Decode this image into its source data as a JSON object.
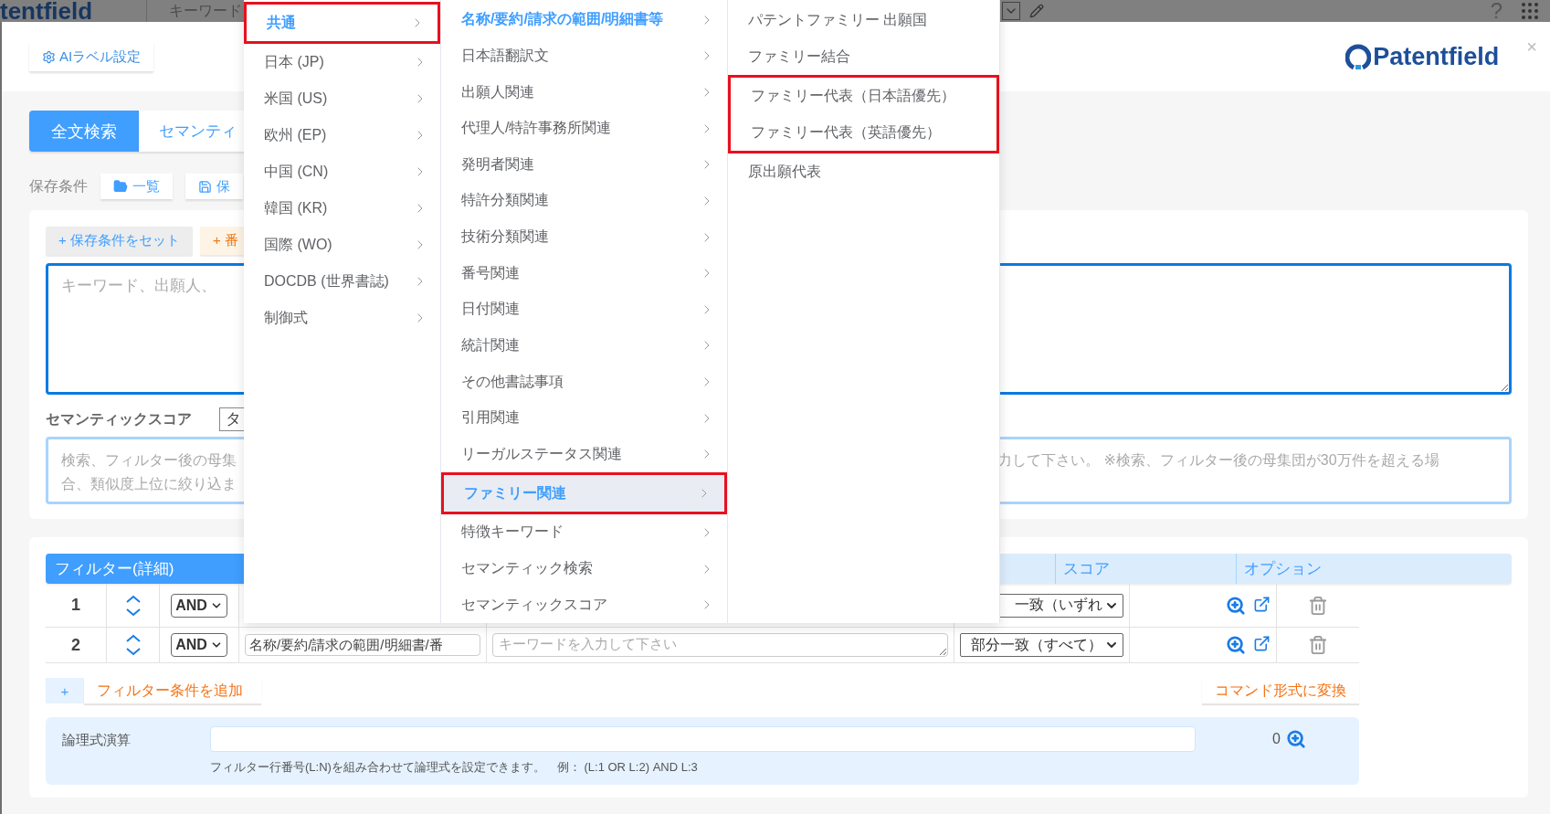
{
  "background": {
    "logo": "tentfield",
    "search_placeholder": "キーワード",
    "help": "?"
  },
  "header": {
    "ai_label_button": "AIラベル設定",
    "logo": "Patentfield",
    "close": "×"
  },
  "tabs": [
    {
      "label": "全文検索",
      "selected": true
    },
    {
      "label": "セマンティ",
      "selected": false
    }
  ],
  "saved_conditions": {
    "label": "保存条件",
    "buttons": [
      {
        "kind": "list",
        "label": "一覧"
      },
      {
        "kind": "save",
        "label": "保"
      }
    ]
  },
  "search": {
    "buttons": [
      {
        "kind": "set",
        "label": "+ 保存条件をセット"
      },
      {
        "kind": "number",
        "label": "+ 番"
      }
    ],
    "placeholder": "キーワード、出願人、"
  },
  "semantic_score": {
    "label": "セマンティックスコア",
    "select": "タ",
    "placeholder_left": [
      "検索、フィルター後の母集",
      "合、類似度上位に絞り込ま"
    ],
    "placeholder_right": "力して下さい。 ※検索、フィルター後の母集団が30万件を超える場"
  },
  "filter": {
    "title": "フィルター(詳細)",
    "columns": [
      "スコア",
      "オプション"
    ],
    "rows": [
      {
        "number": "1",
        "operator": "AND",
        "match": "一致（いずれ"
      },
      {
        "number": "2",
        "operator": "AND",
        "field": "名称/要約/請求の範囲/明細書/番",
        "placeholder": "キーワードを入力して下さい",
        "match": "部分一致（すべて）"
      }
    ],
    "add_button": "+",
    "add_label": "フィルター条件を追加",
    "convert_button": "コマンド形式に変換"
  },
  "logic": {
    "label": "論理式演算",
    "count": "0",
    "help": "フィルター行番号(L:N)を組み合わせて論理式を設定できます。　例：  (L:1 OR L:2) AND L:3"
  },
  "menus": [
    {
      "items": [
        {
          "label": "共通",
          "selected": true,
          "hovered": false,
          "highlighted": true,
          "submenu": true
        },
        {
          "label": "日本 (JP)",
          "selected": false,
          "hovered": false,
          "highlighted": false,
          "submenu": true
        },
        {
          "label": "米国 (US)",
          "selected": false,
          "hovered": false,
          "highlighted": false,
          "submenu": true
        },
        {
          "label": "欧州 (EP)",
          "selected": false,
          "hovered": false,
          "highlighted": false,
          "submenu": true
        },
        {
          "label": "中国 (CN)",
          "selected": false,
          "hovered": false,
          "highlighted": false,
          "submenu": true
        },
        {
          "label": "韓国 (KR)",
          "selected": false,
          "hovered": false,
          "highlighted": false,
          "submenu": true
        },
        {
          "label": "国際 (WO)",
          "selected": false,
          "hovered": false,
          "highlighted": false,
          "submenu": true
        },
        {
          "label": "DOCDB (世界書誌)",
          "selected": false,
          "hovered": false,
          "highlighted": false,
          "submenu": true
        },
        {
          "label": "制御式",
          "selected": false,
          "hovered": false,
          "highlighted": false,
          "submenu": true
        }
      ]
    },
    {
      "items": [
        {
          "label": "名称/要約/請求の範囲/明細書等",
          "selected": true,
          "hovered": false,
          "highlighted": false,
          "submenu": true
        },
        {
          "label": "日本語翻訳文",
          "selected": false,
          "hovered": false,
          "highlighted": false,
          "submenu": true
        },
        {
          "label": "出願人関連",
          "selected": false,
          "hovered": false,
          "highlighted": false,
          "submenu": true
        },
        {
          "label": "代理人/特許事務所関連",
          "selected": false,
          "hovered": false,
          "highlighted": false,
          "submenu": true
        },
        {
          "label": "発明者関連",
          "selected": false,
          "hovered": false,
          "highlighted": false,
          "submenu": true
        },
        {
          "label": "特許分類関連",
          "selected": false,
          "hovered": false,
          "highlighted": false,
          "submenu": true
        },
        {
          "label": "技術分類関連",
          "selected": false,
          "hovered": false,
          "highlighted": false,
          "submenu": true
        },
        {
          "label": "番号関連",
          "selected": false,
          "hovered": false,
          "highlighted": false,
          "submenu": true
        },
        {
          "label": "日付関連",
          "selected": false,
          "hovered": false,
          "highlighted": false,
          "submenu": true
        },
        {
          "label": "統計関連",
          "selected": false,
          "hovered": false,
          "highlighted": false,
          "submenu": true
        },
        {
          "label": "その他書誌事項",
          "selected": false,
          "hovered": false,
          "highlighted": false,
          "submenu": true
        },
        {
          "label": "引用関連",
          "selected": false,
          "hovered": false,
          "highlighted": false,
          "submenu": true
        },
        {
          "label": "リーガルステータス関連",
          "selected": false,
          "hovered": false,
          "highlighted": false,
          "submenu": true
        },
        {
          "label": "ファミリー関連",
          "selected": true,
          "hovered": true,
          "highlighted": true,
          "submenu": true
        },
        {
          "label": "特徴キーワード",
          "selected": false,
          "hovered": false,
          "highlighted": false,
          "submenu": true
        },
        {
          "label": "セマンティック検索",
          "selected": false,
          "hovered": false,
          "highlighted": false,
          "submenu": true
        },
        {
          "label": "セマンティックスコア",
          "selected": false,
          "hovered": false,
          "highlighted": false,
          "submenu": true
        }
      ]
    },
    {
      "items": [
        {
          "label": "パテントファミリー 出願国",
          "selected": false,
          "hovered": false,
          "highlighted": false,
          "submenu": false
        },
        {
          "label": "ファミリー結合",
          "selected": false,
          "hovered": false,
          "highlighted": false,
          "submenu": false
        },
        {
          "label": "ファミリー代表（日本語優先）",
          "selected": false,
          "hovered": false,
          "highlighted": true,
          "submenu": false
        },
        {
          "label": "ファミリー代表（英語優先）",
          "selected": false,
          "hovered": false,
          "highlighted": true,
          "submenu": false
        },
        {
          "label": "原出願代表",
          "selected": false,
          "hovered": false,
          "highlighted": false,
          "submenu": false
        }
      ]
    }
  ]
}
